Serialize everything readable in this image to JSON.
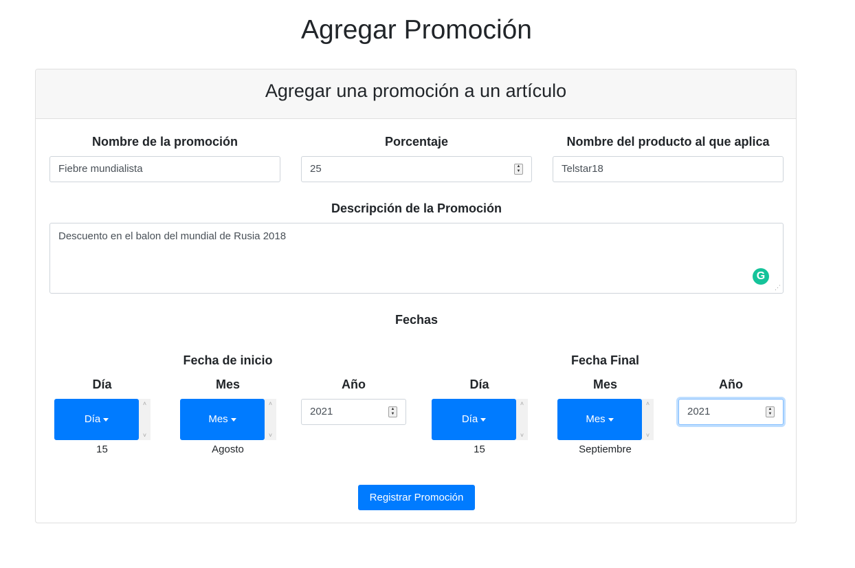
{
  "page": {
    "title": "Agregar Promoción"
  },
  "card": {
    "header": "Agregar una promoción a un artículo"
  },
  "form": {
    "name_label": "Nombre de la promoción",
    "name_value": "Fiebre mundialista",
    "percent_label": "Porcentaje",
    "percent_value": "25",
    "product_label": "Nombre del producto al que aplica",
    "product_value": "Telstar18",
    "description_label": "Descripción de la Promoción",
    "description_value": "Descuento en el balon del mundial de Rusia 2018"
  },
  "dates": {
    "section_label": "Fechas",
    "start": {
      "label": "Fecha de inicio",
      "day_label": "Día",
      "day_button": "Día",
      "day_value": "15",
      "month_label": "Mes",
      "month_button": "Mes",
      "month_value": "Agosto",
      "year_label": "Año",
      "year_value": "2021"
    },
    "end": {
      "label": "Fecha Final",
      "day_label": "Día",
      "day_button": "Día",
      "day_value": "15",
      "month_label": "Mes",
      "month_button": "Mes",
      "month_value": "Septiembre",
      "year_label": "Año",
      "year_value": "2021"
    }
  },
  "submit": {
    "label": "Registrar Promoción"
  },
  "colors": {
    "primary": "#007bff",
    "header_bg": "#f7f7f7",
    "grammarly": "#15c39a"
  },
  "icons": [
    "caret-down-icon",
    "spinner-icon",
    "grammarly-icon",
    "resize-handle-icon",
    "scroll-up-icon",
    "scroll-down-icon"
  ]
}
